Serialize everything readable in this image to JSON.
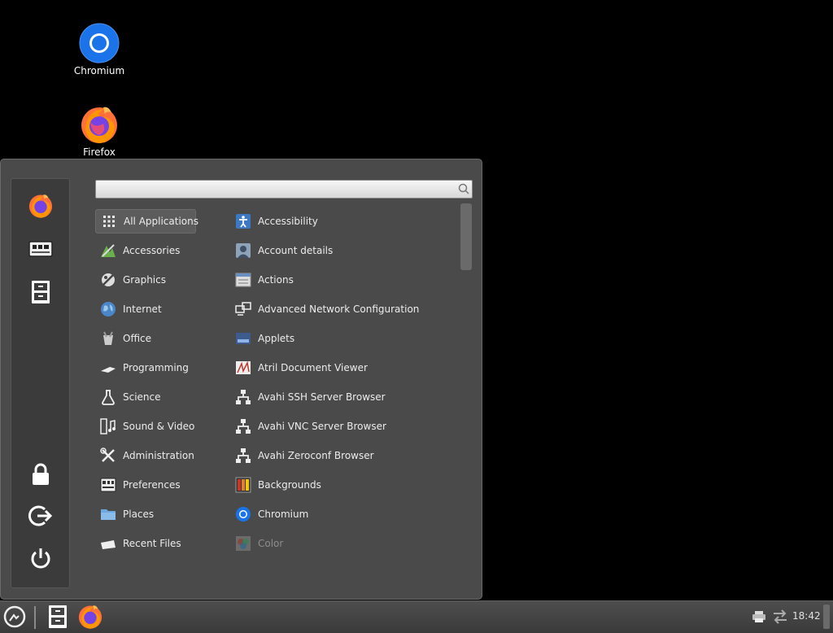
{
  "desktop": {
    "icons": [
      {
        "label": "Chromium"
      },
      {
        "label": "Firefox"
      }
    ]
  },
  "menu": {
    "search": {
      "value": "",
      "placeholder": ""
    },
    "categories": [
      {
        "label": "All Applications",
        "icon": "grid-icon",
        "selected": true
      },
      {
        "label": "Accessories",
        "icon": "accessories-icon"
      },
      {
        "label": "Graphics",
        "icon": "graphics-icon"
      },
      {
        "label": "Internet",
        "icon": "globe-icon"
      },
      {
        "label": "Office",
        "icon": "office-icon"
      },
      {
        "label": "Programming",
        "icon": "programming-icon"
      },
      {
        "label": "Science",
        "icon": "flask-icon"
      },
      {
        "label": "Sound & Video",
        "icon": "film-music-icon"
      },
      {
        "label": "Administration",
        "icon": "tools-icon"
      },
      {
        "label": "Preferences",
        "icon": "preferences-icon"
      },
      {
        "label": "Places",
        "icon": "folder-icon"
      },
      {
        "label": "Recent Files",
        "icon": "recent-files-icon"
      }
    ],
    "apps": [
      {
        "label": "Accessibility",
        "icon": "accessibility-icon"
      },
      {
        "label": "Account details",
        "icon": "user-icon"
      },
      {
        "label": "Actions",
        "icon": "actions-icon"
      },
      {
        "label": "Advanced Network Configuration",
        "icon": "network-icon"
      },
      {
        "label": "Applets",
        "icon": "applets-icon"
      },
      {
        "label": "Atril Document Viewer",
        "icon": "document-viewer-icon"
      },
      {
        "label": "Avahi SSH Server Browser",
        "icon": "network-tree-icon"
      },
      {
        "label": "Avahi VNC Server Browser",
        "icon": "network-tree-icon"
      },
      {
        "label": "Avahi Zeroconf Browser",
        "icon": "network-tree-icon"
      },
      {
        "label": "Backgrounds",
        "icon": "backgrounds-icon"
      },
      {
        "label": "Chromium",
        "icon": "chromium-icon"
      },
      {
        "label": "Color",
        "icon": "color-icon"
      }
    ]
  },
  "taskbar": {
    "clock": "18:42"
  },
  "colors": {
    "menu_bg": "#4a4a4a",
    "favbar_bg": "#3b3b3b",
    "chromium_blue": "#1a73e8",
    "firefox_orange": "#ff7139"
  }
}
